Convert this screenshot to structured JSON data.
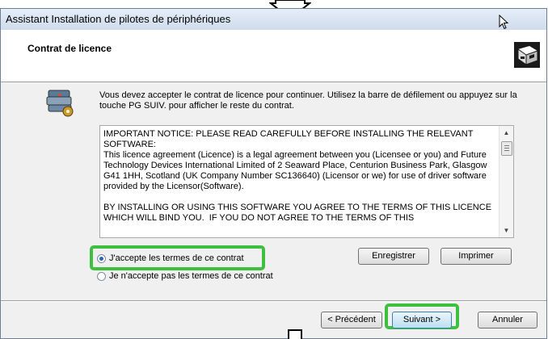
{
  "window": {
    "title": "Assistant Installation de pilotes de périphériques"
  },
  "header": {
    "title": "Contrat de licence",
    "icon": "driver-box-icon"
  },
  "instructions": "Vous devez accepter le contrat de licence pour continuer. Utilisez la barre de défilement ou appuyez sur la touche PG SUIV. pour afficher le reste du contrat.",
  "license": {
    "text": "IMPORTANT NOTICE: PLEASE READ CAREFULLY BEFORE INSTALLING THE RELEVANT SOFTWARE:\nThis licence agreement (Licence) is a legal agreement between you (Licensee or you) and Future Technology Devices International Limited of 2 Seaward Place, Centurion Business Park, Glasgow G41 1HH, Scotland (UK Company Number SC136640) (Licensor or we) for use of driver software provided by the Licensor(Software).\n\nBY INSTALLING OR USING THIS SOFTWARE YOU AGREE TO THE TERMS OF THIS LICENCE WHICH WILL BIND YOU.  IF YOU DO NOT AGREE TO THE TERMS OF THIS"
  },
  "options": {
    "accept": "J'accepte les termes de ce contrat",
    "decline": "Je n'accepte pas les termes de ce contrat",
    "selected": "accept"
  },
  "buttons": {
    "save": "Enregistrer",
    "print": "Imprimer",
    "back": "< Précédent",
    "next": "Suivant >",
    "cancel": "Annuler"
  },
  "colors": {
    "highlight": "#3fbf3f",
    "accent": "#2a66b8"
  }
}
